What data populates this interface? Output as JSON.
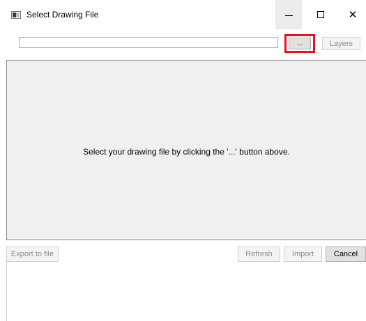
{
  "window": {
    "title": "Select Drawing File",
    "icon": "app-window-icon",
    "controls": [
      "minimize-icon",
      "maximize-icon",
      "close-icon"
    ]
  },
  "toolbar": {
    "path_value": "",
    "browse_label": "...",
    "layers_label": "Layers",
    "browse_highlight_color": "#e81123"
  },
  "main": {
    "message": "Select your drawing file by clicking the '...' button above."
  },
  "footer": {
    "export_label": "Export to file",
    "refresh_label": "Refresh",
    "import_label": "Import",
    "cancel_label": "Cancel"
  }
}
